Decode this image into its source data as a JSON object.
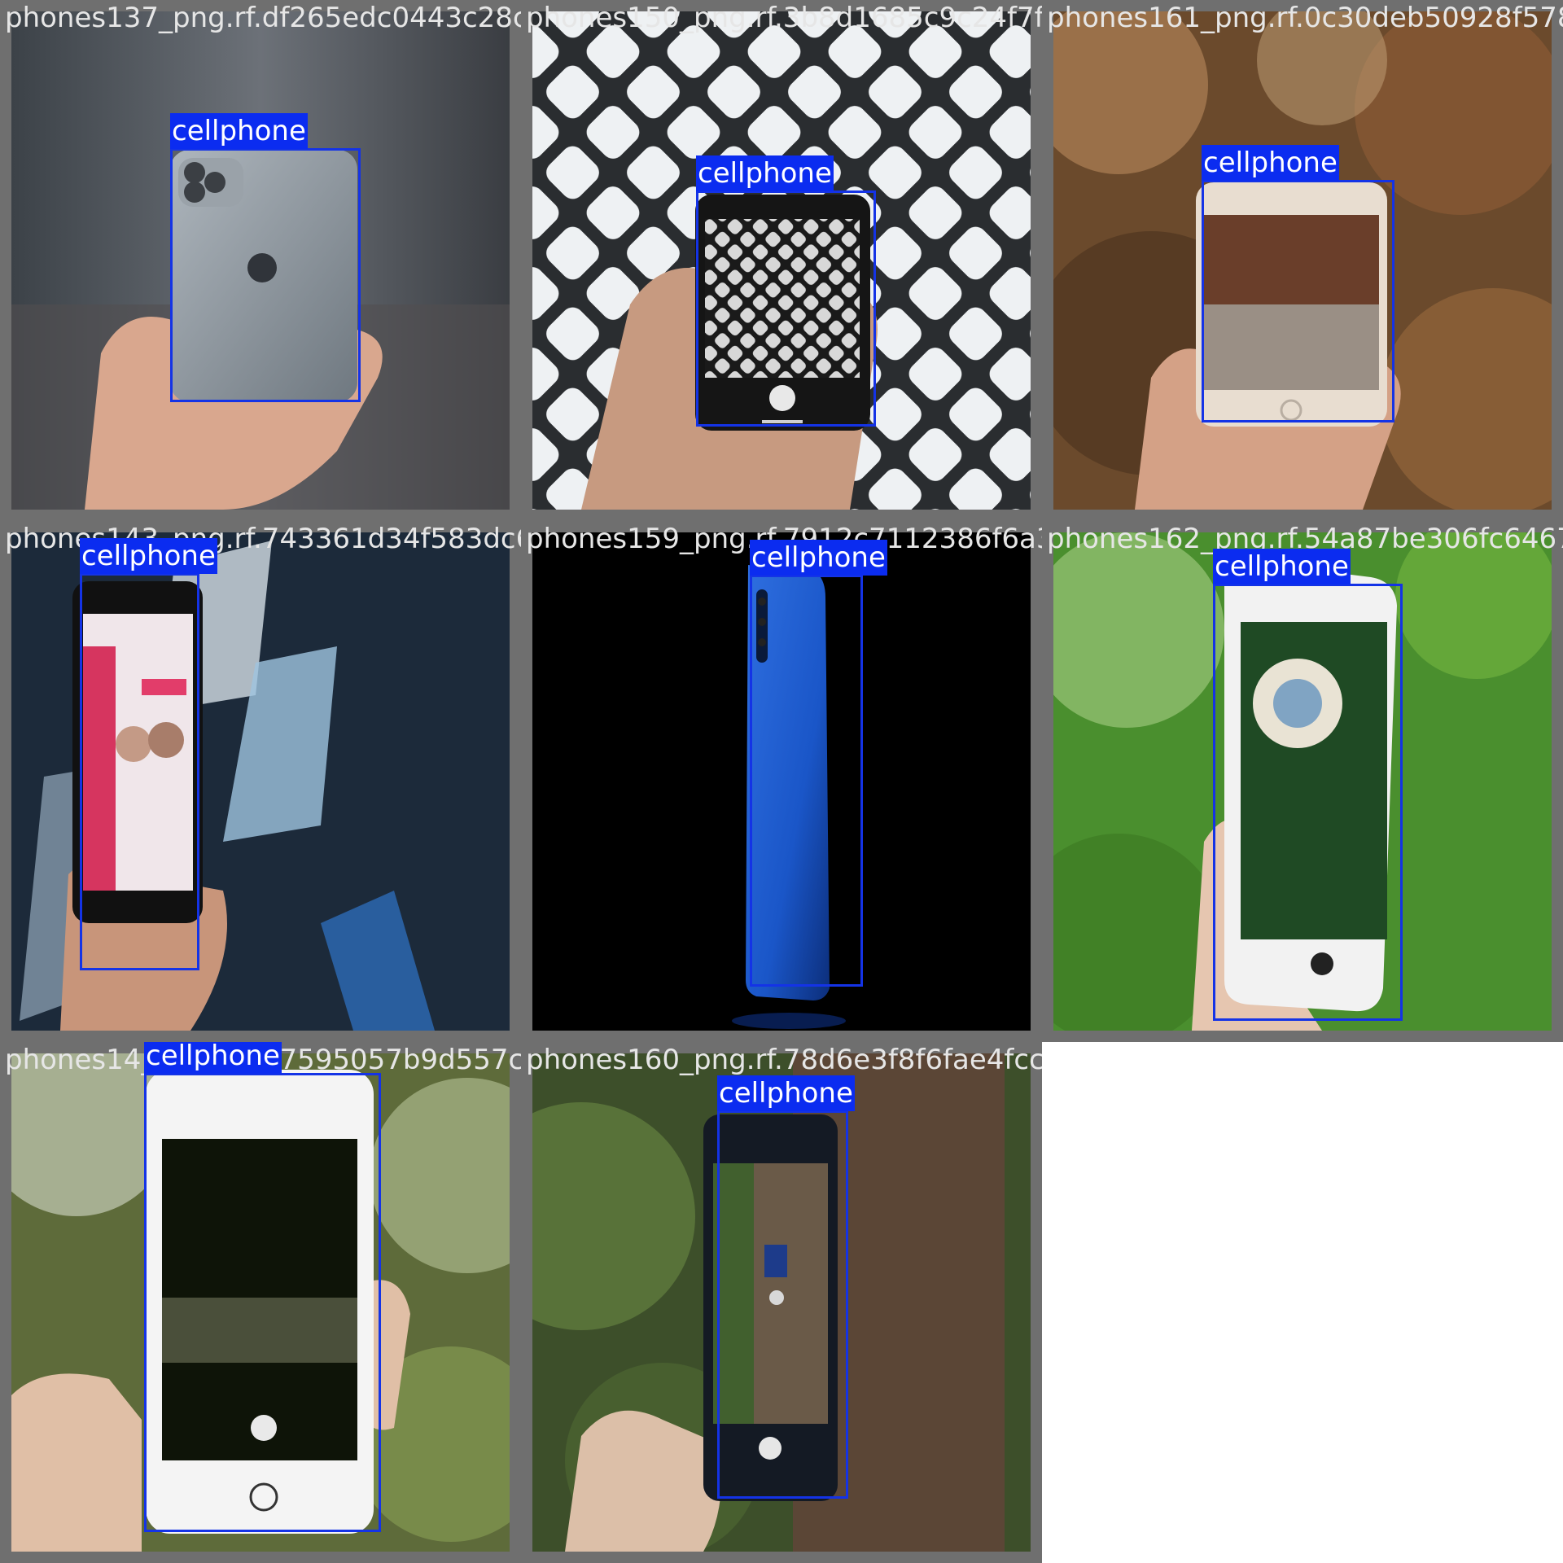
{
  "tiles": [
    {
      "filename": "phones137_png.rf.df265edc0443c28c3fbb9e3",
      "label": "cellphone"
    },
    {
      "filename": "phones150_png.rf.3b8d1685c9c24f7f8b04f6",
      "label": "cellphone"
    },
    {
      "filename": "phones161_png.rf.0c30deb50928f578",
      "label": "cellphone"
    },
    {
      "filename": "phones143_png.rf.743361d34f583dc6",
      "label": "cellphone"
    },
    {
      "filename": "phones159_png.rf.7912c7112386f6a3ff",
      "label": "cellphone"
    },
    {
      "filename": "phones162_png.rf.54a87be306fc6467",
      "label": "cellphone"
    },
    {
      "filename": "phones14_png.rf.717595057b9d557c",
      "label": "cellphone"
    },
    {
      "filename": "phones160_png.rf.78d6e3f8f6fae4fcc42adaf",
      "label": "cellphone"
    }
  ],
  "colors": {
    "box": "#1433e6",
    "label_bg": "#0b2cf0",
    "tile_border": "#6f6f6f",
    "filename_text": "#e6e6e6"
  }
}
